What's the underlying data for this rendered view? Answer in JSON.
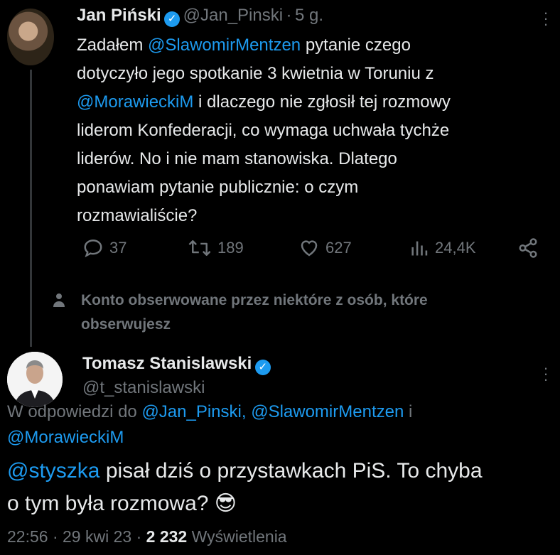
{
  "tweet1": {
    "author_name": "Jan Piński",
    "handle": "@Jan_Pinski",
    "sep": "·",
    "time_ago": "5 g.",
    "text_lines": [
      {
        "pre": "Zadałem ",
        "mention": "@SlawomirMentzen",
        "post": " pytanie czego"
      },
      {
        "pre": "dotyczyło jego spotkanie 3 kwietnia w Toruniu z",
        "mention": "",
        "post": ""
      },
      {
        "pre": "",
        "mention": "@MorawieckiM",
        "post": " i dlaczego nie zgłosił tej rozmowy"
      },
      {
        "pre": "liderom Konfederacji, co wymaga uchwała tychże",
        "mention": "",
        "post": ""
      },
      {
        "pre": "liderów. No i nie mam stanowiska. Dlatego",
        "mention": "",
        "post": ""
      },
      {
        "pre": "ponawiam pytanie publicznie: o czym",
        "mention": "",
        "post": ""
      },
      {
        "pre": "rozmawialiście?",
        "mention": "",
        "post": ""
      }
    ],
    "actions": {
      "replies": "37",
      "retweets": "189",
      "likes": "627",
      "views": "24,4K"
    }
  },
  "notice": {
    "line1": "Konto obserwowane przez niektóre z osób, które",
    "line2": "obserwujesz"
  },
  "tweet2": {
    "author_name": "Tomasz Stanislawski",
    "handle": "@t_stanislawski",
    "reply_to_label": "W odpowiedzi do",
    "reply_to_1": "@Jan_Pinski,",
    "reply_to_2": "@SlawomirMentzen",
    "reply_to_and": "i",
    "reply_to_3": "@MorawieckiM",
    "text_mention": "@styszka",
    "text_rest_1": " pisał dziś o przystawkach PiS. To chyba",
    "text_line2": "o tym była rozmowa?",
    "emoji": "😎",
    "time": "22:56",
    "sep": "·",
    "date": "29 kwi 23",
    "views_count": "2 232",
    "views_label": "Wyświetlenia"
  },
  "icons": {
    "verified": "verified-badge-icon",
    "more": "more-dots-icon",
    "reply": "reply-icon",
    "retweet": "retweet-icon",
    "like": "heart-icon",
    "views": "views-bars-icon",
    "share": "share-icon",
    "person": "person-icon"
  },
  "colors": {
    "background": "#000000",
    "text": "#e7e9ea",
    "secondary": "#71767b",
    "accent": "#1d9bf0"
  }
}
